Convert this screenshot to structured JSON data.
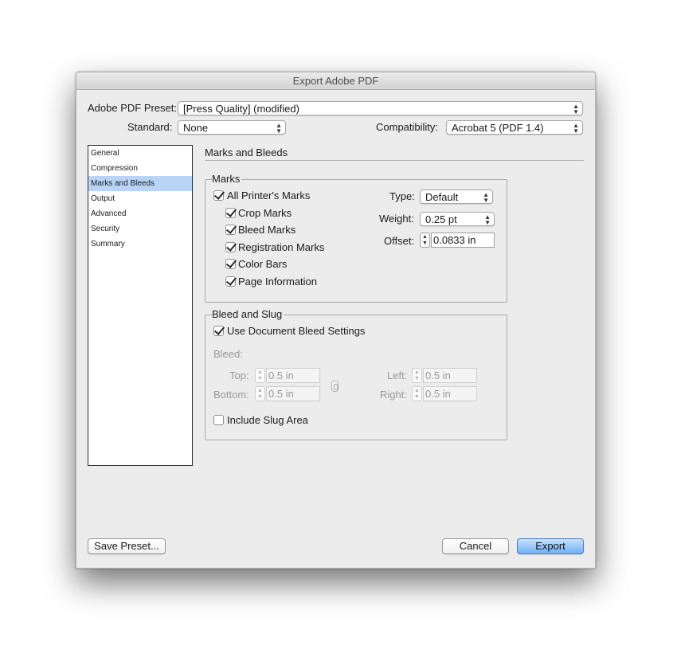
{
  "window": {
    "title": "Export Adobe PDF"
  },
  "preset": {
    "label": "Adobe PDF Preset:",
    "value": "[Press Quality] (modified)"
  },
  "standard": {
    "label": "Standard:",
    "value": "None"
  },
  "compatibility": {
    "label": "Compatibility:",
    "value": "Acrobat 5 (PDF 1.4)"
  },
  "sidebar": {
    "items": [
      {
        "label": "General"
      },
      {
        "label": "Compression"
      },
      {
        "label": "Marks and Bleeds",
        "selected": true
      },
      {
        "label": "Output"
      },
      {
        "label": "Advanced"
      },
      {
        "label": "Security"
      },
      {
        "label": "Summary"
      }
    ]
  },
  "section": {
    "title": "Marks and Bleeds"
  },
  "marks": {
    "title": "Marks",
    "all_printers_marks": {
      "label": "All Printer's Marks",
      "checked": true
    },
    "items": [
      {
        "label": "Crop Marks",
        "checked": true
      },
      {
        "label": "Bleed Marks",
        "checked": true
      },
      {
        "label": "Registration Marks",
        "checked": true
      },
      {
        "label": "Color Bars",
        "checked": true
      },
      {
        "label": "Page Information",
        "checked": true
      }
    ],
    "type": {
      "label": "Type:",
      "value": "Default"
    },
    "weight": {
      "label": "Weight:",
      "value": "0.25 pt"
    },
    "offset": {
      "label": "Offset:",
      "value": "0.0833 in"
    }
  },
  "bleed_slug": {
    "title": "Bleed and Slug",
    "use_document_bleed": {
      "label": "Use Document Bleed Settings",
      "checked": true
    },
    "bleed_label": "Bleed:",
    "top": {
      "label": "Top:",
      "value": "0.5 in"
    },
    "bottom": {
      "label": "Bottom:",
      "value": "0.5 in"
    },
    "left": {
      "label": "Left:",
      "value": "0.5 in"
    },
    "right": {
      "label": "Right:",
      "value": "0.5 in"
    },
    "include_slug": {
      "label": "Include Slug Area",
      "checked": false
    }
  },
  "buttons": {
    "save_preset": "Save Preset...",
    "cancel": "Cancel",
    "export": "Export"
  },
  "colors": {
    "accent": "#6fb0f7",
    "selection": "#b8d5f7"
  }
}
